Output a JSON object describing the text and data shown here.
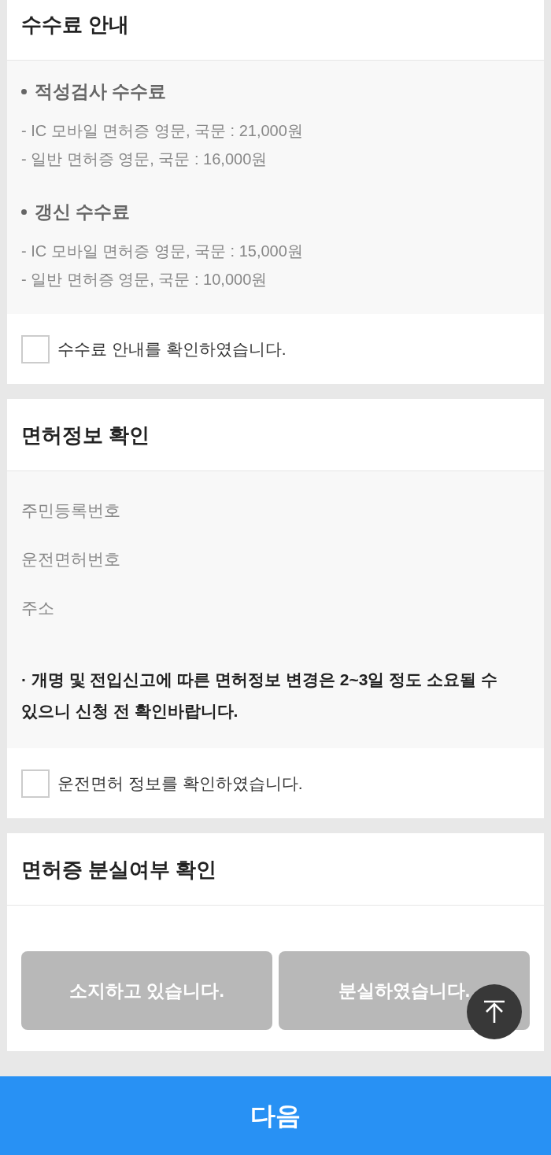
{
  "sections": [
    {
      "kind": "fees",
      "title": "수수료 안내",
      "groups": [
        {
          "heading": "적성검사 수수료",
          "lines": [
            "- IC 모바일 면허증 영문, 국문 : 21,000원",
            "- 일반 면허증 영문, 국문 : 16,000원"
          ]
        },
        {
          "heading": "갱신 수수료",
          "lines": [
            "- IC 모바일 면허증 영문, 국문 : 15,000원",
            "- 일반 면허증 영문, 국문 : 10,000원"
          ]
        }
      ],
      "confirm": {
        "label": "수수료 안내를 확인하였습니다.",
        "checked": false
      }
    },
    {
      "kind": "info",
      "title": "면허정보 확인",
      "fields": [
        "주민등록번호",
        "운전면허번호",
        "주소"
      ],
      "notice": "· 개명 및 전입신고에 따른 면허정보 변경은 2~3일 정도 소요될 수 있으니 신청 전 확인바랍니다.",
      "confirm": {
        "label": "운전면허 정보를 확인하였습니다.",
        "checked": false
      }
    },
    {
      "kind": "choice",
      "title": "면허증 분실여부 확인",
      "options": [
        {
          "label": "소지하고 있습니다.",
          "selected": false
        },
        {
          "label": "분실하였습니다.",
          "selected": false
        }
      ]
    }
  ],
  "next_button": "다음"
}
